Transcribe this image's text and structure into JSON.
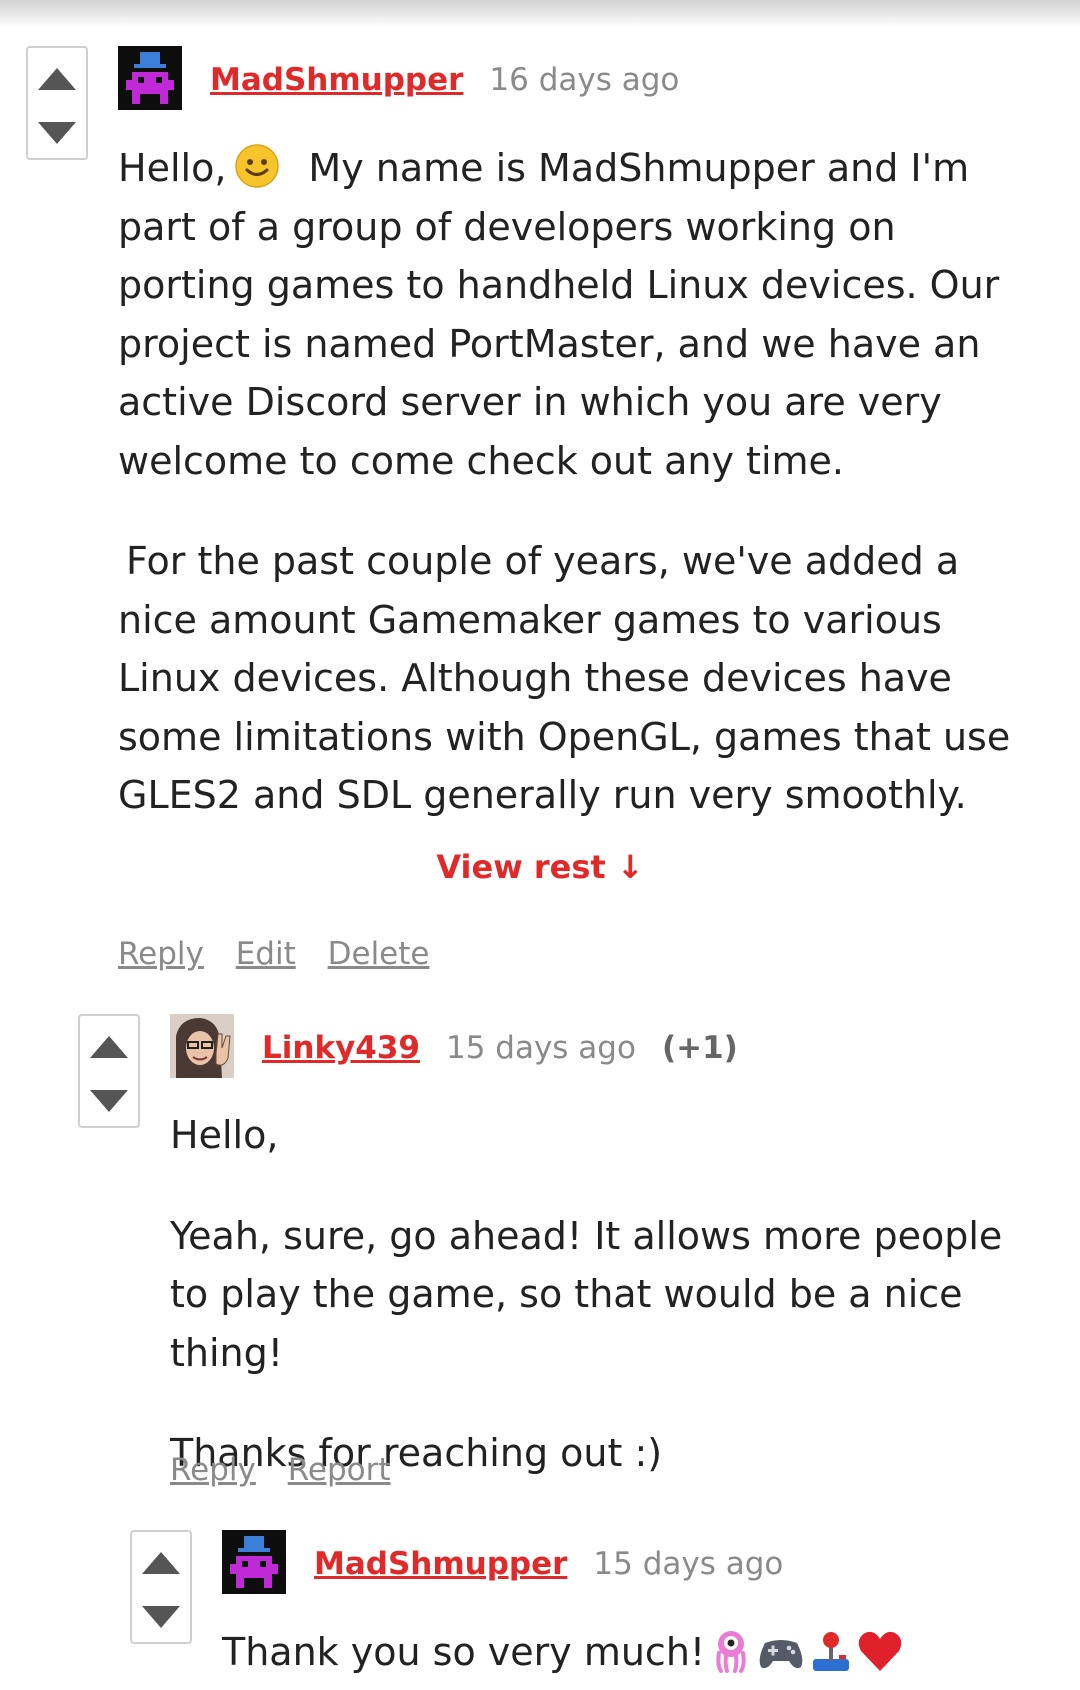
{
  "comments": [
    {
      "author": "MadShmupper",
      "time": "16 days ago",
      "paragraphs": [
        "My name is MadShmupper and I'm part of a group of developers working on porting games to handheld Linux devices. Our project is named PortMaster, and we have an active Discord server in which you are very welcome to come check out any time.",
        "For the past couple of years, we've added a nice amount Gamemaker games to various Linux devices. Although these devices have some limitations with OpenGL, games that use GLES2 and SDL generally run very smoothly."
      ],
      "greeting": "Hello,",
      "view_rest": "View rest ↓",
      "actions": [
        "Reply",
        "Edit",
        "Delete"
      ]
    },
    {
      "author": "Linky439",
      "time": "15 days ago",
      "score": "(+1)",
      "paragraphs": [
        "Hello,",
        "Yeah, sure, go ahead! It allows more people to play the game, so that would be a nice thing!",
        "Thanks for reaching out :)"
      ],
      "actions": [
        "Reply",
        "Report"
      ]
    },
    {
      "author": "MadShmupper",
      "time": "15 days ago",
      "text": "Thank you so very much!",
      "emojis": [
        "alien-monster-emoji",
        "game-controller-emoji",
        "joystick-emoji",
        "red-heart-emoji"
      ]
    }
  ],
  "colors": {
    "accent": "#e02a2a",
    "muted": "#8a8a8a",
    "text": "#222222"
  }
}
